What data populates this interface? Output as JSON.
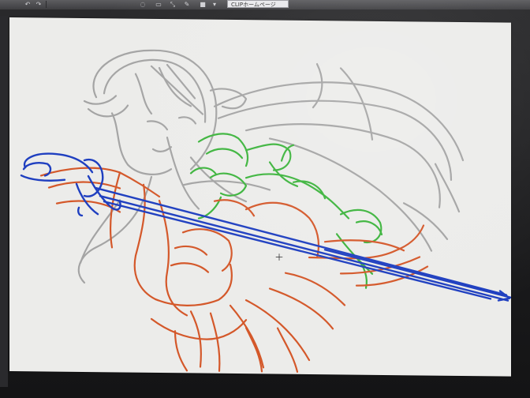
{
  "toolbar": {
    "homepage_button_label": "CLIPホームページ",
    "icons": [
      "undo-icon",
      "redo-icon",
      "lasso-icon",
      "select-icon",
      "transform-icon",
      "pen-tool-icon",
      "layer-color-icon",
      "dropdown-icon"
    ]
  },
  "canvas": {
    "background_color": "#ececea",
    "layers": [
      {
        "name": "gray-rough-sketch",
        "color": "#9d9d9d"
      },
      {
        "name": "green-sketch",
        "color": "#3cb43c"
      },
      {
        "name": "orange-sketch",
        "color": "#d4582a"
      },
      {
        "name": "blue-sword-sketch",
        "color": "#1f3fc0"
      }
    ]
  }
}
